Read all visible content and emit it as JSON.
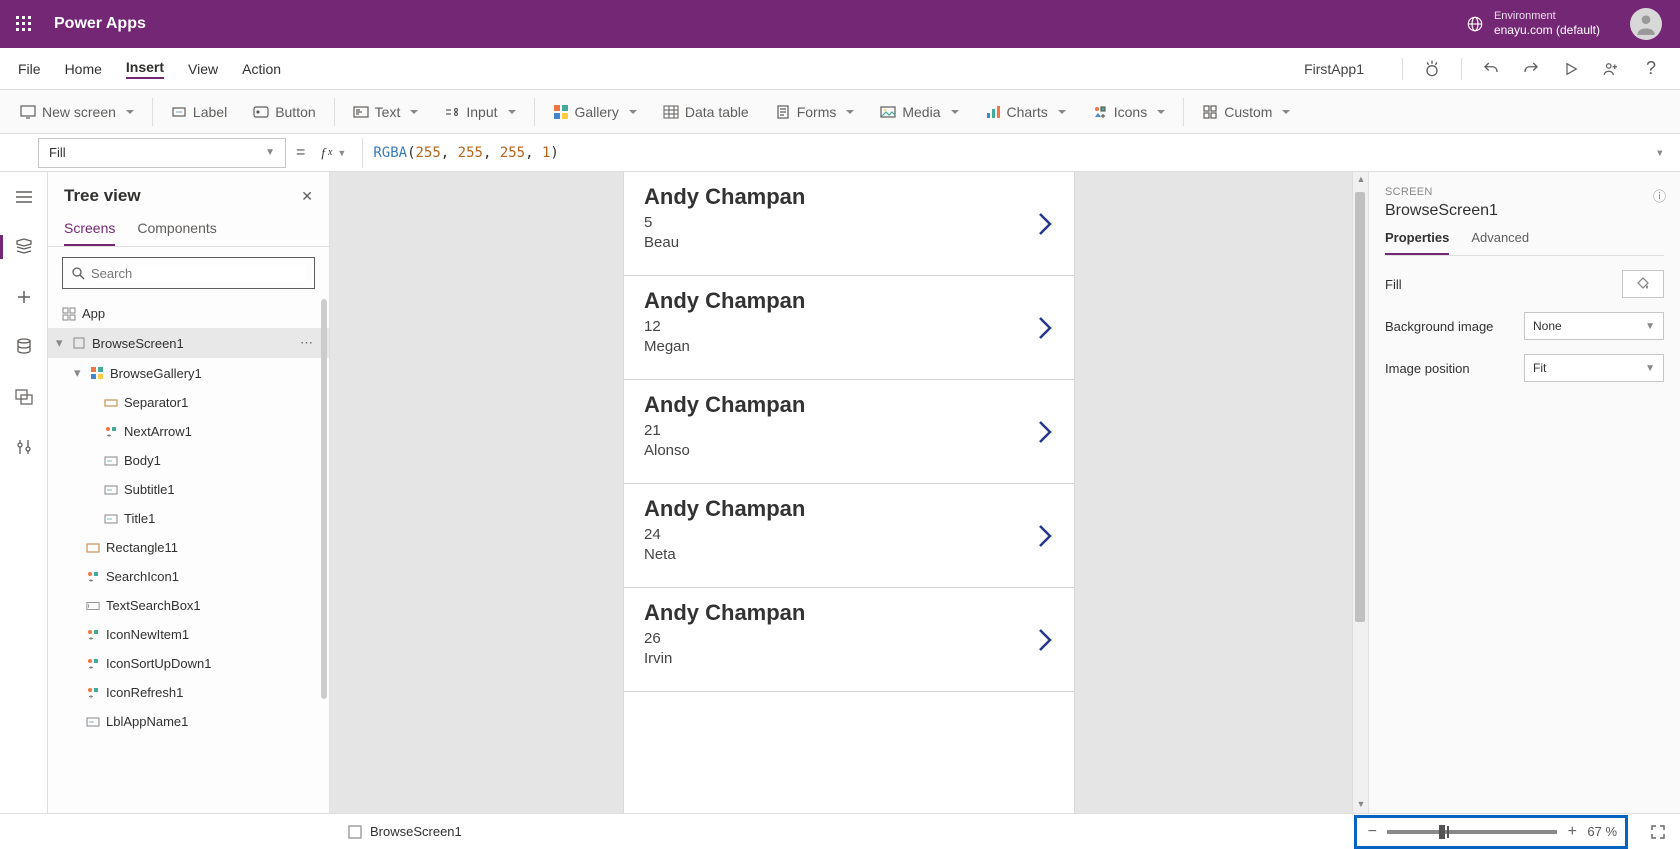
{
  "topbar": {
    "title": "Power Apps",
    "env_label": "Environment",
    "env_name": "enayu.com (default)"
  },
  "menubar": {
    "items": [
      "File",
      "Home",
      "Insert",
      "View",
      "Action"
    ],
    "active_index": 2,
    "app_name": "FirstApp1"
  },
  "ribbon": {
    "new_screen": "New screen",
    "label": "Label",
    "button": "Button",
    "text": "Text",
    "input": "Input",
    "gallery": "Gallery",
    "data_table": "Data table",
    "forms": "Forms",
    "media": "Media",
    "charts": "Charts",
    "icons": "Icons",
    "custom": "Custom"
  },
  "formula": {
    "property": "Fill",
    "func": "RGBA",
    "arg1": "255",
    "arg2": "255",
    "arg3": "255",
    "arg4": "1"
  },
  "tree": {
    "title": "Tree view",
    "tab_screens": "Screens",
    "tab_components": "Components",
    "search_placeholder": "Search",
    "nodes": {
      "app": "App",
      "browsescreen": "BrowseScreen1",
      "gallery": "BrowseGallery1",
      "separator": "Separator1",
      "nextarrow": "NextArrow1",
      "body": "Body1",
      "subtitle": "Subtitle1",
      "title": "Title1",
      "rectangle": "Rectangle11",
      "searchicon": "SearchIcon1",
      "textsearch": "TextSearchBox1",
      "iconnew": "IconNewItem1",
      "iconsort": "IconSortUpDown1",
      "iconrefresh": "IconRefresh1",
      "lblappname": "LblAppName1"
    }
  },
  "gallery": [
    {
      "title": "Andy Champan",
      "subtitle": "5",
      "body": "Beau"
    },
    {
      "title": "Andy Champan",
      "subtitle": "12",
      "body": "Megan"
    },
    {
      "title": "Andy Champan",
      "subtitle": "21",
      "body": "Alonso"
    },
    {
      "title": "Andy Champan",
      "subtitle": "24",
      "body": "Neta"
    },
    {
      "title": "Andy Champan",
      "subtitle": "26",
      "body": "Irvin"
    }
  ],
  "props": {
    "eyebrow": "SCREEN",
    "name": "BrowseScreen1",
    "tab_properties": "Properties",
    "tab_advanced": "Advanced",
    "fill_label": "Fill",
    "bg_label": "Background image",
    "bg_value": "None",
    "pos_label": "Image position",
    "pos_value": "Fit"
  },
  "status": {
    "screen_name": "BrowseScreen1",
    "zoom": "67",
    "pct": "%"
  }
}
